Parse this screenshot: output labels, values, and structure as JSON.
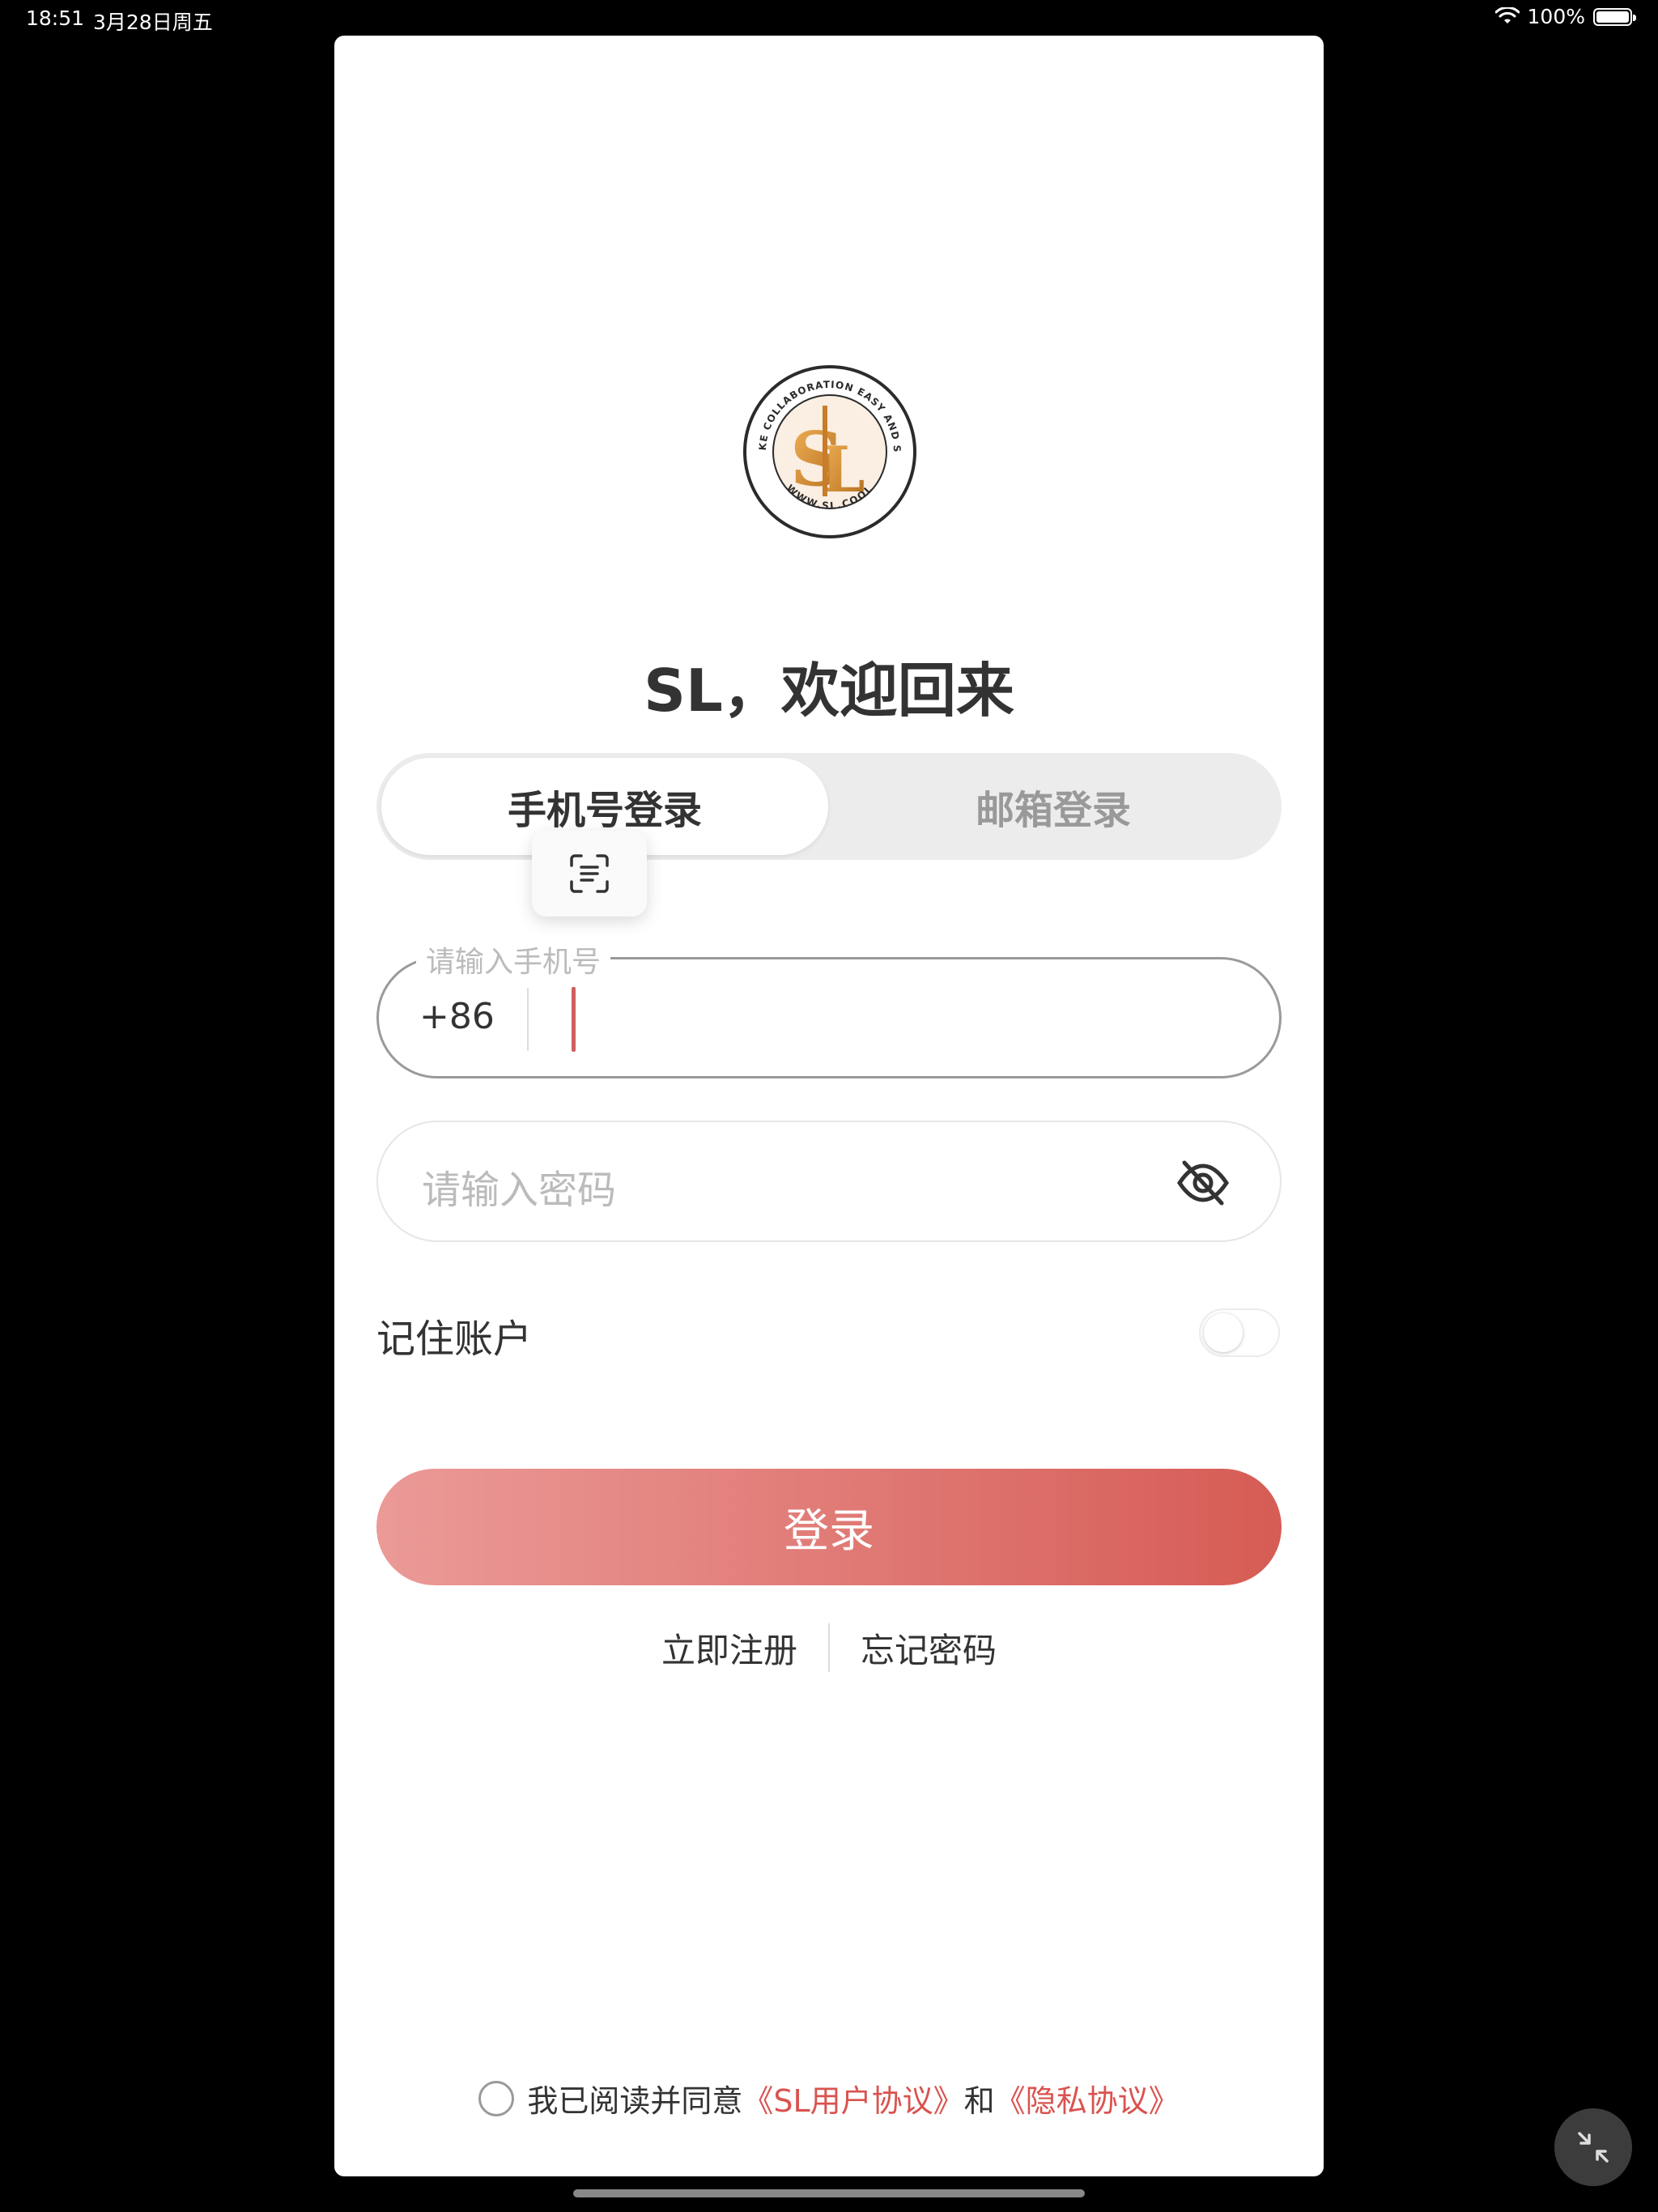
{
  "status_bar": {
    "time": "18:51",
    "date": "3月28日周五",
    "battery": "100%",
    "battery_level": 1.0
  },
  "welcome_title": "SL，欢迎回来",
  "logo": {
    "ring_text_top": "TO MAKE COLLABORATION EASY AND SIMPLE",
    "ring_text_bottom": "WWW.SL.COOL"
  },
  "tabs": [
    {
      "label": "手机号登录",
      "active": true
    },
    {
      "label": "邮箱登录",
      "active": false
    }
  ],
  "phone_field": {
    "floating_label": "请输入手机号",
    "country_code": "+86",
    "value": ""
  },
  "password_field": {
    "placeholder": "请输入密码"
  },
  "remember": {
    "label": "记住账户",
    "on": false
  },
  "login_button": "登录",
  "links": {
    "register": "立即注册",
    "forgot": "忘记密码"
  },
  "agreement": {
    "prefix": "我已阅读并同意",
    "user_agreement": "《SL用户协议》",
    "and": "和",
    "privacy": "《隐私协议》"
  },
  "colors": {
    "accent": "#d9534f",
    "button_start": "#eb9a98",
    "button_end": "#d65c55"
  }
}
